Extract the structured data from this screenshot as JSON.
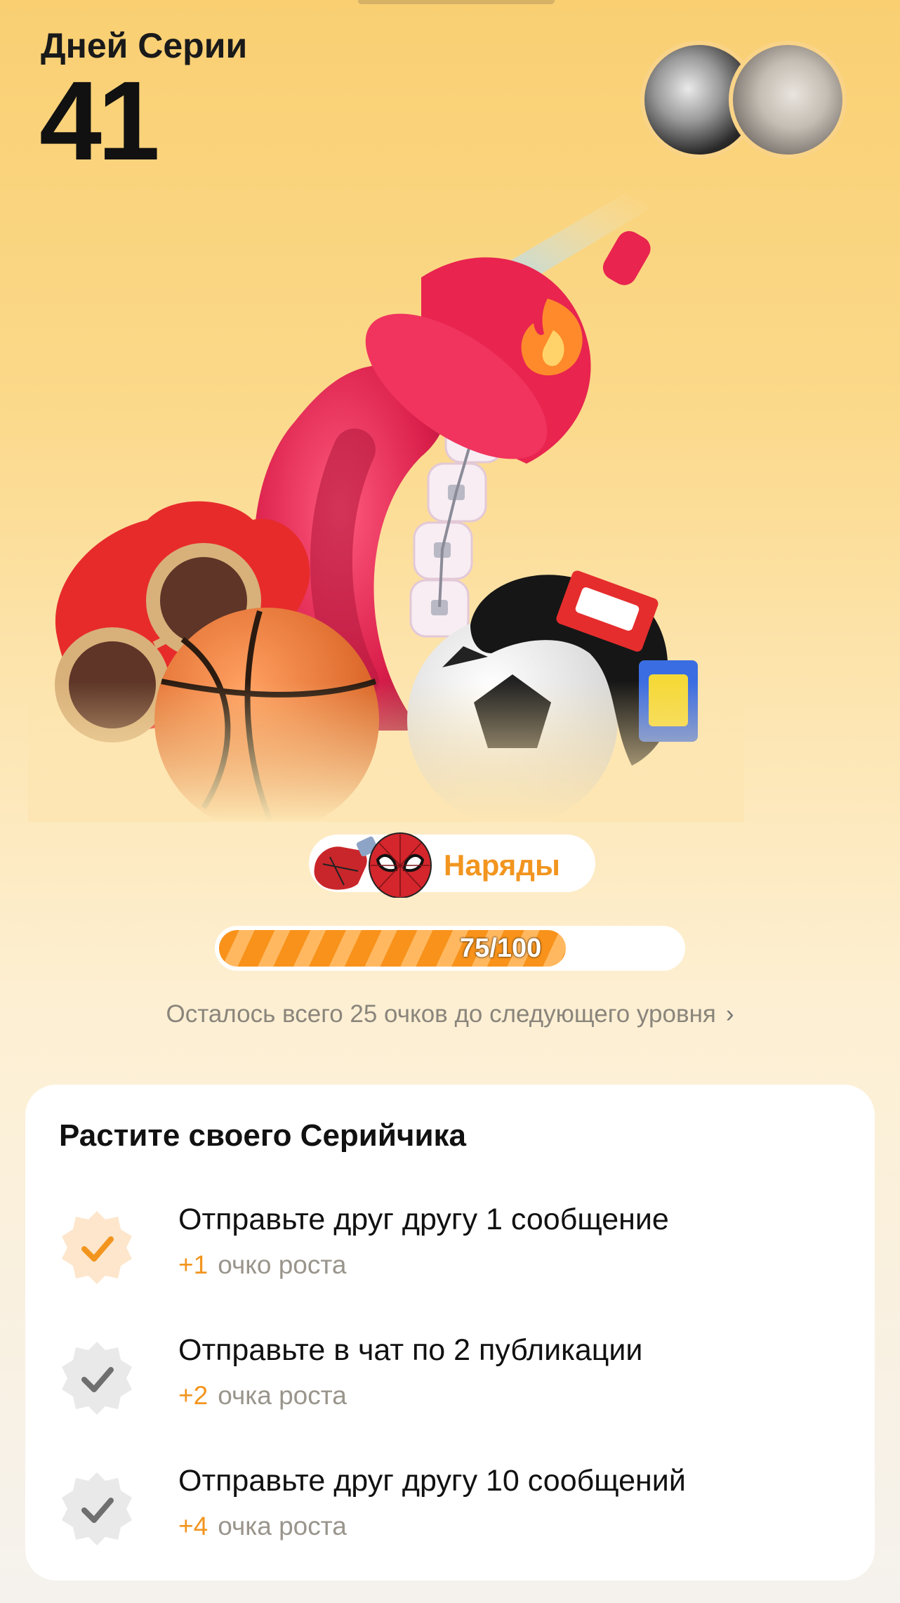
{
  "streak": {
    "label": "Дней Серии",
    "count": "41"
  },
  "avatars": [
    {
      "name": "friend-avatar-1"
    },
    {
      "name": "friend-avatar-2"
    }
  ],
  "outfits": {
    "label": "Наряды"
  },
  "progress": {
    "text": "75/100",
    "value": 75,
    "max": 100
  },
  "hint": {
    "text": "Осталось всего 25 очков до следующего уровня",
    "chevron": "›"
  },
  "card": {
    "title": "Растите своего Серийчика",
    "tasks": [
      {
        "title": "Отправьте друг другу 1 сообщение",
        "points": "+1",
        "unit": "очко роста",
        "completed": true
      },
      {
        "title": "Отправьте в чат по 2 публикации",
        "points": "+2",
        "unit": "очка роста",
        "completed": false
      },
      {
        "title": "Отправьте друг другу 10 сообщений",
        "points": "+4",
        "unit": "очка роста",
        "completed": false
      }
    ]
  },
  "colors": {
    "accent": "#f2951f",
    "pending_badge": "#e6e6e6",
    "done_badge": "#fde6cc"
  }
}
